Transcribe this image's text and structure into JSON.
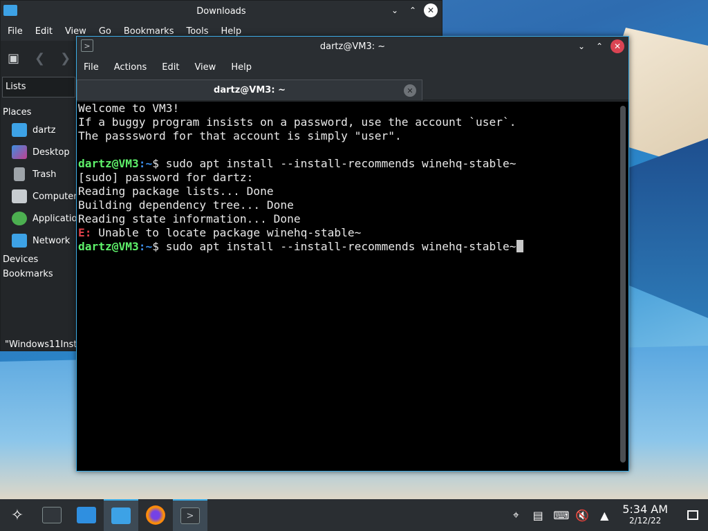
{
  "dolphin": {
    "title": "Downloads",
    "menu": [
      "File",
      "Edit",
      "View",
      "Go",
      "Bookmarks",
      "Tools",
      "Help"
    ],
    "lists_label": "Lists",
    "places_header": "Places",
    "places": [
      "dartz",
      "Desktop",
      "Trash",
      "Computer",
      "Applications",
      "Network"
    ],
    "devices_header": "Devices",
    "bookmarks_header": "Bookmarks",
    "status_text": "\"Windows11Insta"
  },
  "konsole": {
    "title": "dartz@VM3: ~",
    "menu": [
      "File",
      "Actions",
      "Edit",
      "View",
      "Help"
    ],
    "tab_label": "dartz@VM3: ~",
    "lines": [
      "Welcome to VM3!",
      "If a buggy program insists on a password, use the account `user`.",
      "The passsword for that account is simply \"user\"."
    ],
    "prompt_user": "dartz@VM3",
    "prompt_path": ":~",
    "prompt_end": "$ ",
    "command1": "sudo apt install --install-recommends winehq-stable~",
    "output": [
      "[sudo] password for dartz:",
      "Reading package lists... Done",
      "Building dependency tree... Done",
      "Reading state information... Done"
    ],
    "error_prefix": "E:",
    "error_text": " Unable to locate package winehq-stable~",
    "command2": "sudo apt install --install-recommends winehq-stable~"
  },
  "taskbar": {
    "time": "5:34 AM",
    "date": "2/12/22"
  },
  "colors": {
    "accent": "#3daee9",
    "prompt_green": "#5ef06a",
    "prompt_blue": "#3b8eea",
    "error_red": "#e0404a",
    "close_red": "#da4453"
  }
}
